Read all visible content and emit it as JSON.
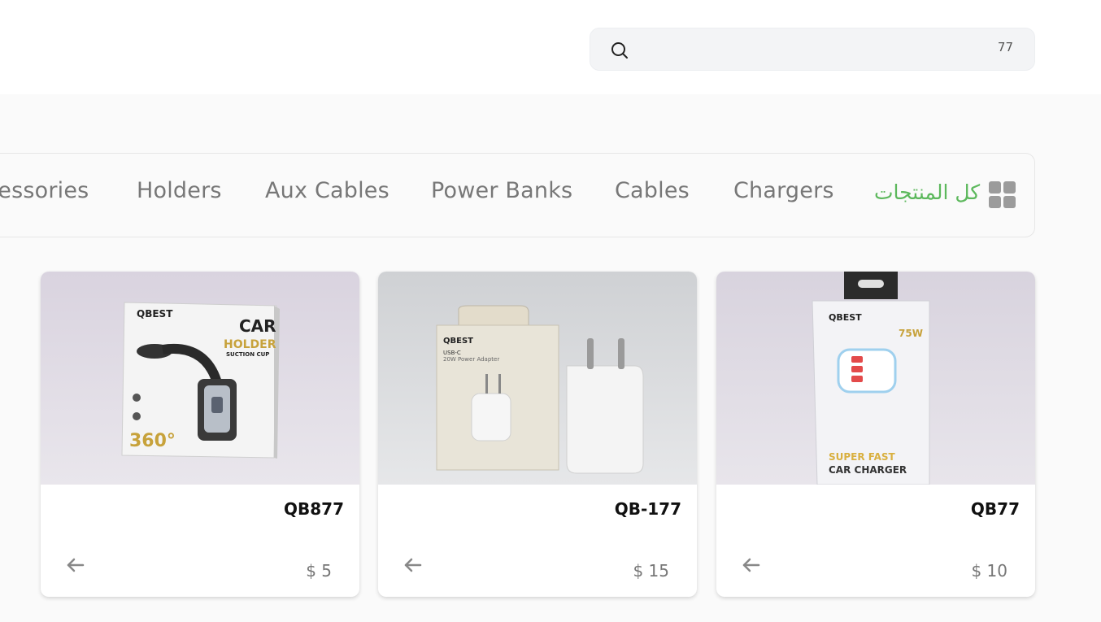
{
  "search": {
    "value": "77",
    "icon": "search-icon"
  },
  "categories": [
    {
      "label": "كل المنتجات",
      "active": true
    },
    {
      "label": "Chargers",
      "active": false
    },
    {
      "label": "Cables",
      "active": false
    },
    {
      "label": "Power Banks",
      "active": false
    },
    {
      "label": "Aux Cables",
      "active": false
    },
    {
      "label": "Holders",
      "active": false
    },
    {
      "label": "Accessories",
      "active": false
    }
  ],
  "category_icon": "grid-icon",
  "accent_color": "#5cb85c",
  "products": [
    {
      "name": "QB877",
      "price": "$ 5",
      "image_label": "car holder suction cup box",
      "arrow_icon": "arrow-left-icon"
    },
    {
      "name": "QB-177",
      "price": "$ 15",
      "image_label": "USB-C 20W power adapter",
      "arrow_icon": "arrow-left-icon"
    },
    {
      "name": "QB77",
      "price": "$ 10",
      "image_label": "super fast car charger 75W",
      "arrow_icon": "arrow-left-icon"
    }
  ],
  "image_text": {
    "brand": "QBEST",
    "holder": {
      "line1": "CAR",
      "line2": "HOLDER",
      "line3": "SUCTION CUP",
      "badge": "360°"
    },
    "adapter": {
      "line1": "USB-C",
      "line2": "20W Power Adapter"
    },
    "car_charger": {
      "watt": "75W",
      "line1": "SUPER FAST",
      "line2": "CAR CHARGER"
    }
  }
}
